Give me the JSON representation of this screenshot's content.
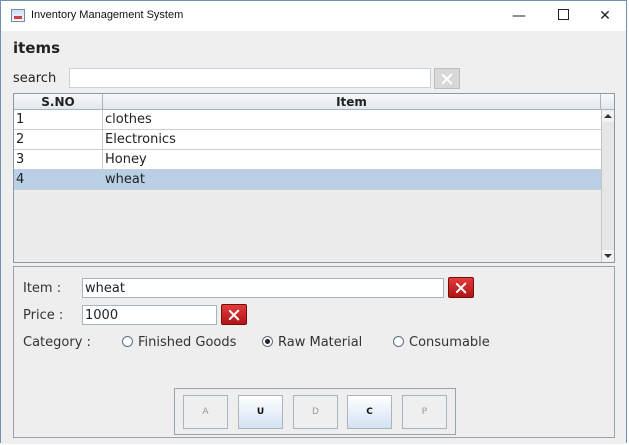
{
  "window": {
    "title": "Inventory Management System",
    "controls": {
      "minimize": "—",
      "close": "✕"
    }
  },
  "page": {
    "heading": "items"
  },
  "search": {
    "label": "search",
    "value": ""
  },
  "table": {
    "headers": {
      "sno": "S.NO",
      "item": "Item"
    },
    "rows": [
      {
        "sno": "1",
        "item": "clothes",
        "selected": false
      },
      {
        "sno": "2",
        "item": "Electronics",
        "selected": false
      },
      {
        "sno": "3",
        "item": "Honey",
        "selected": false
      },
      {
        "sno": "4",
        "item": "wheat",
        "selected": true
      }
    ]
  },
  "form": {
    "item_label": "Item :",
    "item_value": "wheat",
    "price_label": "Price :",
    "price_value": "1000",
    "category_label": "Category :",
    "categories": [
      {
        "label": "Finished Goods",
        "checked": false
      },
      {
        "label": "Raw Material",
        "checked": true
      },
      {
        "label": "Consumable",
        "checked": false
      }
    ]
  },
  "buttons": [
    {
      "label": "A",
      "enabled": false
    },
    {
      "label": "U",
      "enabled": true
    },
    {
      "label": "D",
      "enabled": false
    },
    {
      "label": "C",
      "enabled": true
    },
    {
      "label": "P",
      "enabled": false
    }
  ],
  "colors": {
    "selection": "#b8cfe5",
    "clear_button_red": "#c41f1f"
  }
}
